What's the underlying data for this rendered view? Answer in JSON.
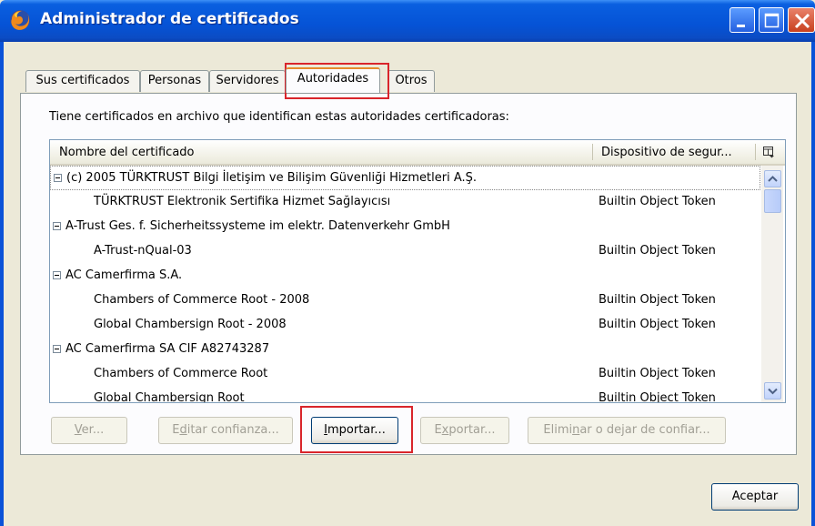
{
  "window": {
    "title": "Administrador de certificados"
  },
  "tabs": [
    {
      "label": "Sus certificados",
      "active": false
    },
    {
      "label": "Personas",
      "active": false
    },
    {
      "label": "Servidores",
      "active": false
    },
    {
      "label": "Autoridades",
      "active": true
    },
    {
      "label": "Otros",
      "active": false
    }
  ],
  "description": "Tiene certificados en archivo que identifican estas autoridades certificadoras:",
  "table": {
    "columns": {
      "name": "Nombre del certificado",
      "device": "Dispositivo de segur..."
    },
    "rows": [
      {
        "type": "group",
        "name": "(c) 2005 TÜRKTRUST Bilgi İletişim ve Bilişim Güvenliği Hizmetleri A.Ş.",
        "device": ""
      },
      {
        "type": "item",
        "name": "TÜRKTRUST Elektronik Sertifika Hizmet Sağlayıcısı",
        "device": "Builtin Object Token"
      },
      {
        "type": "group",
        "name": "A-Trust Ges. f. Sicherheitssysteme im elektr. Datenverkehr GmbH",
        "device": ""
      },
      {
        "type": "item",
        "name": "A-Trust-nQual-03",
        "device": "Builtin Object Token"
      },
      {
        "type": "group",
        "name": "AC Camerfirma S.A.",
        "device": ""
      },
      {
        "type": "item",
        "name": "Chambers of Commerce Root - 2008",
        "device": "Builtin Object Token"
      },
      {
        "type": "item",
        "name": "Global Chambersign Root - 2008",
        "device": "Builtin Object Token"
      },
      {
        "type": "group",
        "name": "AC Camerfirma SA CIF A82743287",
        "device": ""
      },
      {
        "type": "item",
        "name": "Chambers of Commerce Root",
        "device": "Builtin Object Token"
      },
      {
        "type": "item",
        "name": "Global Chambersign Root",
        "device": "Builtin Object Token"
      }
    ]
  },
  "buttons": {
    "ver": {
      "pre": "",
      "key": "V",
      "post": "er..."
    },
    "editar": {
      "pre": "E",
      "key": "d",
      "post": "itar confianza..."
    },
    "importar": {
      "pre": "",
      "key": "I",
      "post": "mportar..."
    },
    "exportar": {
      "pre": "E",
      "key": "x",
      "post": "portar..."
    },
    "eliminar": {
      "pre": "Elimi",
      "key": "n",
      "post": "ar o dejar de confiar..."
    },
    "aceptar": "Aceptar"
  },
  "colors": {
    "titlebar": "#0553d6",
    "highlight": "#d9252b",
    "active_tab_accent": "#e68b2c"
  }
}
